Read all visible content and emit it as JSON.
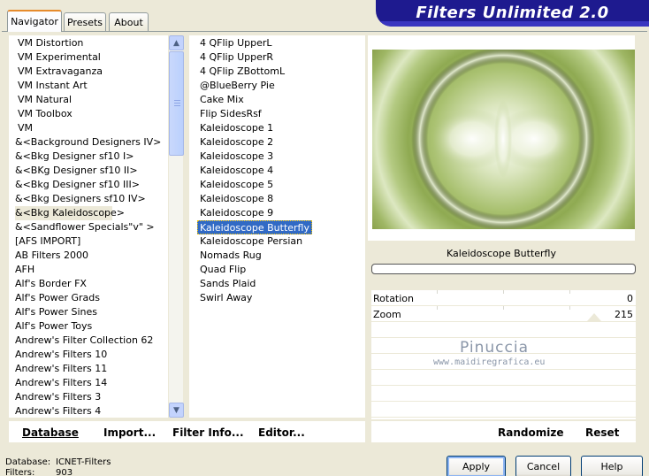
{
  "tabs": [
    {
      "label": "Navigator"
    },
    {
      "label": "Presets"
    },
    {
      "label": "About"
    }
  ],
  "banner_title": "Filters Unlimited 2.0",
  "categories": [
    "VM Distortion",
    "VM Experimental",
    "VM Extravaganza",
    "VM Instant Art",
    "VM Natural",
    "VM Toolbox",
    "VM",
    "&<Background Designers IV>",
    "&<Bkg Designer sf10 I>",
    "&<BKg Designer sf10 II>",
    "&<Bkg Designer sf10 III>",
    "&<Bkg Designers sf10 IV>",
    "&<Bkg Kaleidoscope>",
    "&<Sandflower Specials\"v\" >",
    "[AFS IMPORT]",
    "AB Filters 2000",
    "AFH",
    "Alf's Border FX",
    "Alf's Power Grads",
    "Alf's Power Sines",
    "Alf's Power Toys",
    "Andrew's Filter Collection 62",
    "Andrew's Filters 10",
    "Andrew's Filters 11",
    "Andrew's Filters 14",
    "Andrew's Filters 3",
    "Andrew's Filters 4"
  ],
  "filters": [
    "4 QFlip UpperL",
    "4 QFlip UpperR",
    "4 QFlip ZBottomL",
    "@BlueBerry Pie",
    "Cake Mix",
    "Flip SidesRsf",
    "Kaleidoscope 1",
    "Kaleidoscope 2",
    "Kaleidoscope 3",
    "Kaleidoscope 4",
    "Kaleidoscope 5",
    "Kaleidoscope 8",
    "Kaleidoscope 9",
    "Kaleidoscope Butterfly",
    "Kaleidoscope Persian",
    "Nomads Rug",
    "Quad Flip",
    "Sands Plaid",
    "Swirl Away"
  ],
  "selected_filter_name": "Kaleidoscope Butterfly",
  "params": [
    {
      "label": "Rotation",
      "value": "0"
    },
    {
      "label": "Zoom",
      "value": "215"
    }
  ],
  "watermark": {
    "title": "Pinuccia",
    "url": "www.maidiregrafica.eu"
  },
  "bottom_buttons": {
    "database": "Database",
    "import": "Import...",
    "filter_info": "Filter Info...",
    "editor": "Editor...",
    "randomize": "Randomize",
    "reset": "Reset"
  },
  "status": {
    "database_label": "Database:",
    "database_value": "ICNET-Filters",
    "filters_label": "Filters:",
    "filters_value": "903"
  },
  "dialog_buttons": {
    "apply": "Apply",
    "cancel": "Cancel",
    "help": "Help"
  },
  "colors": {
    "banner": "#1e1a8f",
    "selection": "#316ac5",
    "preview_green": "#8faa52"
  }
}
